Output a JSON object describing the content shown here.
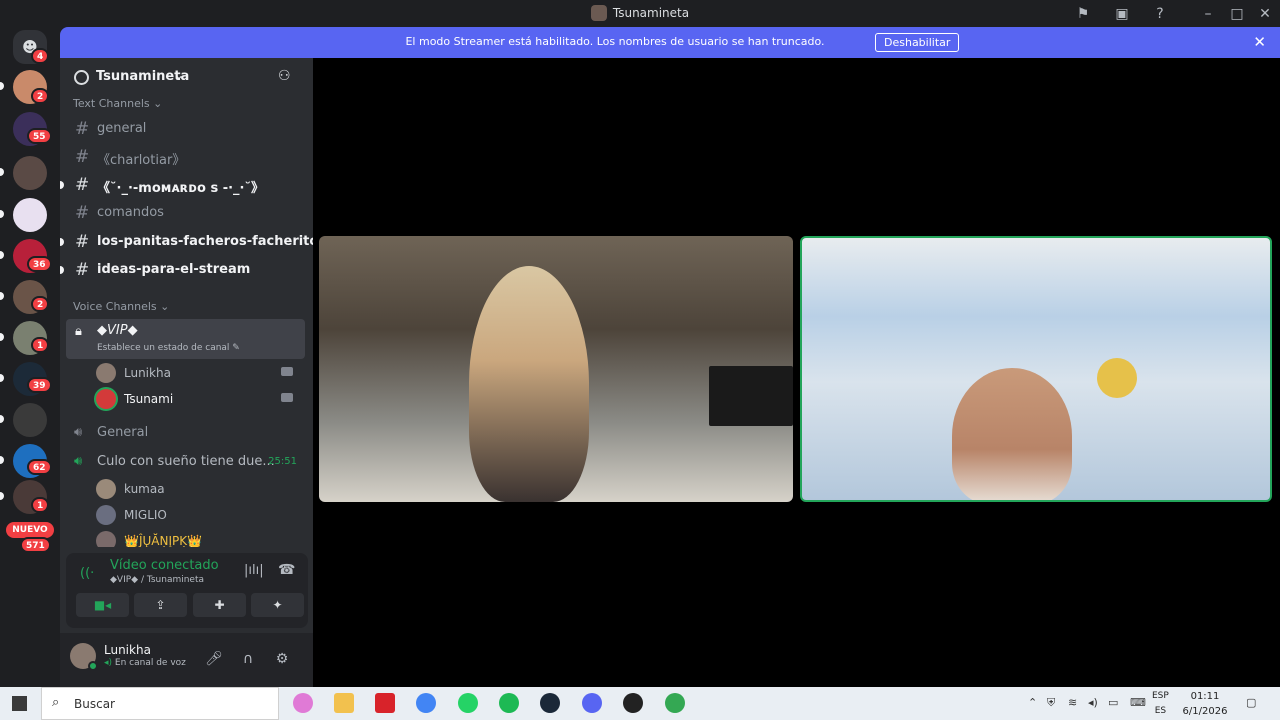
{
  "window": {
    "title": "Tsunamineta"
  },
  "banner": {
    "message": "El modo Streamer está habilitado. Los nombres de usuario se han truncado.",
    "button": "Deshabilitar"
  },
  "rail": {
    "badges": [
      "4",
      "2",
      "55",
      "36",
      "2",
      "1",
      "39",
      "62",
      "1",
      "571"
    ],
    "new_label": "NUEVO"
  },
  "guild": {
    "name": "Tsunamineta"
  },
  "text_channels": {
    "category": "Text Channels",
    "items": [
      {
        "name": "general"
      },
      {
        "name": "《charlotiar》"
      },
      {
        "name": "《˘·_·-moᴍᴀʀᴅo s -·_·˘》"
      },
      {
        "name": "comandos"
      },
      {
        "name": "los-panitas-facheros-facheritos"
      },
      {
        "name": "ideas-para-el-stream"
      }
    ]
  },
  "voice_channels": {
    "category": "Voice Channels",
    "vip": {
      "name": "◆VIP◆",
      "status": "Establece un estado de canal"
    },
    "vip_users": [
      "Lunikha",
      "Tsunami"
    ],
    "general": "General",
    "culo": {
      "name": "Culo con sueño tiene due...",
      "timer": "25:51"
    },
    "culo_users": [
      "kumaa",
      "MIGLIO",
      "👑ĴŲĂŅĮPĶ👑"
    ]
  },
  "rtc": {
    "status": "Vídeo conectado",
    "location": "◆VIP◆ / Tsunamineta"
  },
  "user": {
    "name": "Lunikha",
    "status": "En canal de voz"
  },
  "taskbar": {
    "search": "Buscar",
    "lang_top": "ESP",
    "lang_bottom": "ES",
    "time": "01:11",
    "date": "6/1/2026"
  }
}
